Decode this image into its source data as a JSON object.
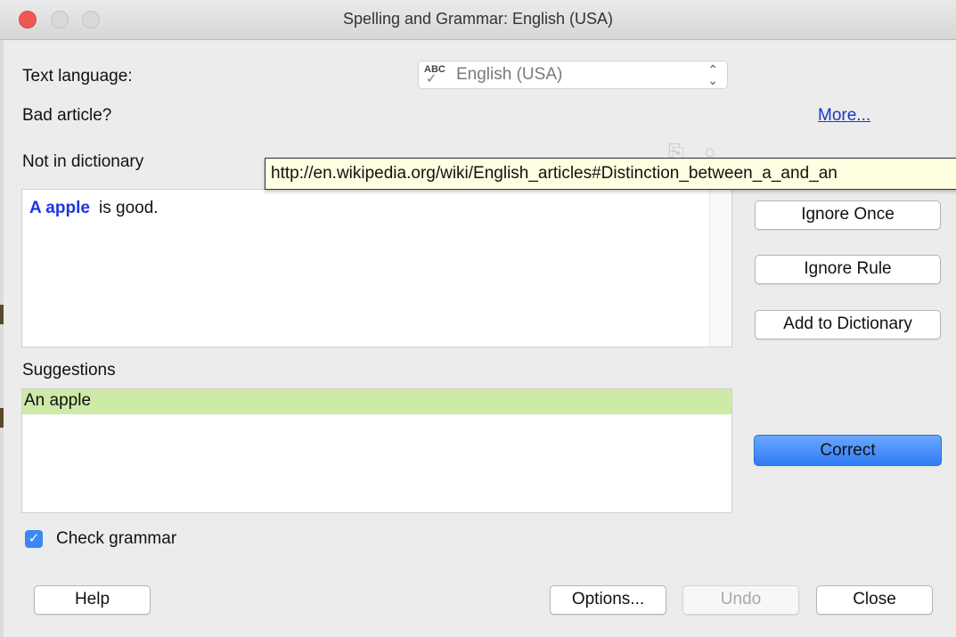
{
  "window": {
    "title": "Spelling and Grammar: English (USA)"
  },
  "language": {
    "label": "Text language:",
    "value": "English (USA)",
    "icon": "spellcheck-icon"
  },
  "error": {
    "description": "Bad article?",
    "more_link": "More...",
    "not_in_dictionary_label": "Not in dictionary",
    "tooltip_url": "http://en.wikipedia.org/wiki/English_articles#Distinction_between_a_and_an"
  },
  "sentence": {
    "error_text": "A apple",
    "rest_text": " is good."
  },
  "suggestions": {
    "label": "Suggestions",
    "items": [
      "An apple"
    ]
  },
  "buttons": {
    "ignore_once": "Ignore Once",
    "ignore_rule": "Ignore Rule",
    "add_to_dictionary": "Add to Dictionary",
    "correct": "Correct",
    "help": "Help",
    "options": "Options...",
    "undo": "Undo",
    "close": "Close"
  },
  "check_grammar": {
    "label": "Check grammar",
    "checked": true
  },
  "colors": {
    "error_text": "#1d35e0",
    "suggestion_highlight": "#cdeaa6",
    "primary_button": "#3b88f5",
    "close_light": "#ee5a52"
  }
}
